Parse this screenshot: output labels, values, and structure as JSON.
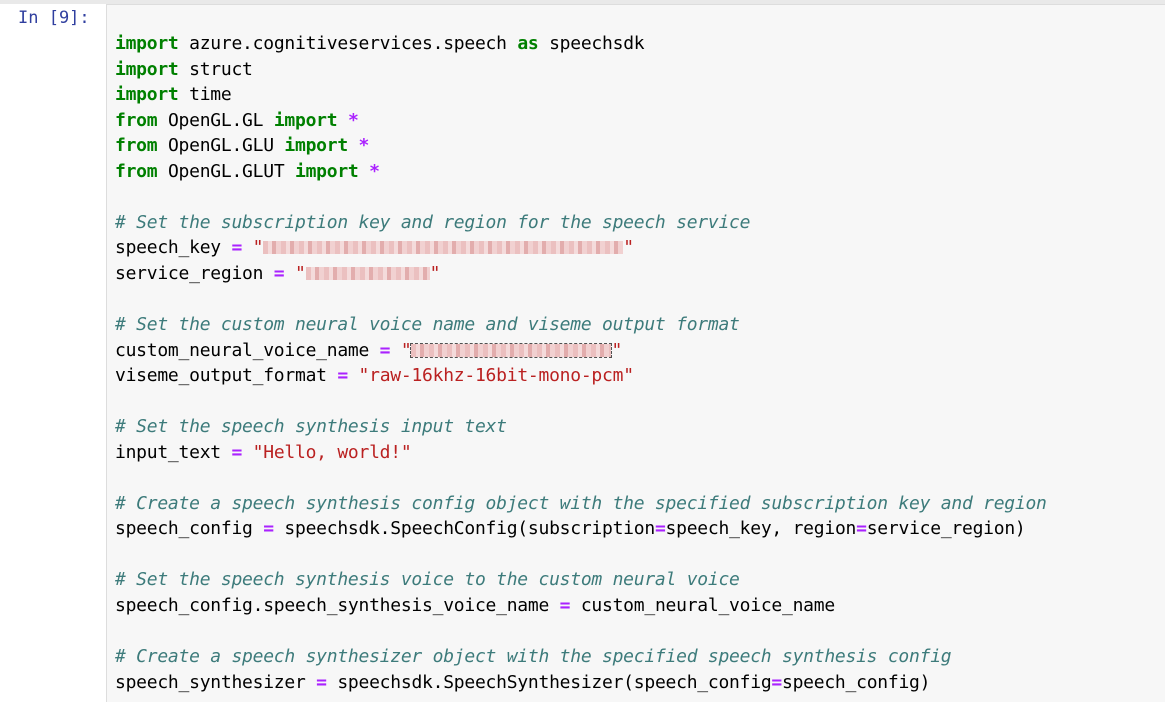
{
  "cell": {
    "prompt": "In [9]:"
  },
  "code": {
    "l1": {
      "kw1": "import",
      "t1": " azure.cognitiveservices.speech ",
      "kw2": "as",
      "t2": " speechsdk"
    },
    "l2": {
      "kw1": "import",
      "t1": " struct"
    },
    "l3": {
      "kw1": "import",
      "t1": " time"
    },
    "l4": {
      "kw1": "from",
      "t1": " OpenGL.GL ",
      "kw2": "import",
      "op": " *"
    },
    "l5": {
      "kw1": "from",
      "t1": " OpenGL.GLU ",
      "kw2": "import",
      "op": " *"
    },
    "l6": {
      "kw1": "from",
      "t1": " OpenGL.GLUT ",
      "kw2": "import",
      "op": " *"
    },
    "l8": {
      "comment": "# Set the subscription key and region for the speech service"
    },
    "l9": {
      "name": "speech_key",
      "eq": " = ",
      "q1": "\"",
      "q2": "\""
    },
    "l10": {
      "name": "service_region",
      "eq": " = ",
      "q1": "\"",
      "q2": "\""
    },
    "l12": {
      "comment": "# Set the custom neural voice name and viseme output format"
    },
    "l13": {
      "name": "custom_neural_voice_name",
      "eq": " = ",
      "q1": "\"",
      "q2": "\""
    },
    "l14": {
      "name": "viseme_output_format",
      "eq": " = ",
      "str": "\"raw-16khz-16bit-mono-pcm\""
    },
    "l16": {
      "comment": "# Set the speech synthesis input text"
    },
    "l17": {
      "name": "input_text",
      "eq": " = ",
      "str": "\"Hello, world!\""
    },
    "l19": {
      "comment": "# Create a speech synthesis config object with the specified subscription key and region"
    },
    "l20": {
      "t1": "speech_config ",
      "eq1": "=",
      "t2": " speechsdk.SpeechConfig(subscription",
      "eq2": "=",
      "t3": "speech_key, region",
      "eq3": "=",
      "t4": "service_region)"
    },
    "l22": {
      "comment": "# Set the speech synthesis voice to the custom neural voice"
    },
    "l23": {
      "t1": "speech_config.speech_synthesis_voice_name ",
      "eq1": "=",
      "t2": " custom_neural_voice_name"
    },
    "l25": {
      "comment": "# Create a speech synthesizer object with the specified speech synthesis config"
    },
    "l26": {
      "t1": "speech_synthesizer ",
      "eq1": "=",
      "t2": " speechsdk.SpeechSynthesizer(speech_config",
      "eq2": "=",
      "t3": "speech_config)"
    }
  },
  "colors": {
    "keyword": "#008000",
    "operator": "#aa22ff",
    "string": "#ba2121",
    "comment": "#3d7b7b",
    "prompt": "#303f9f",
    "editor_background": "#f7f7f7"
  }
}
